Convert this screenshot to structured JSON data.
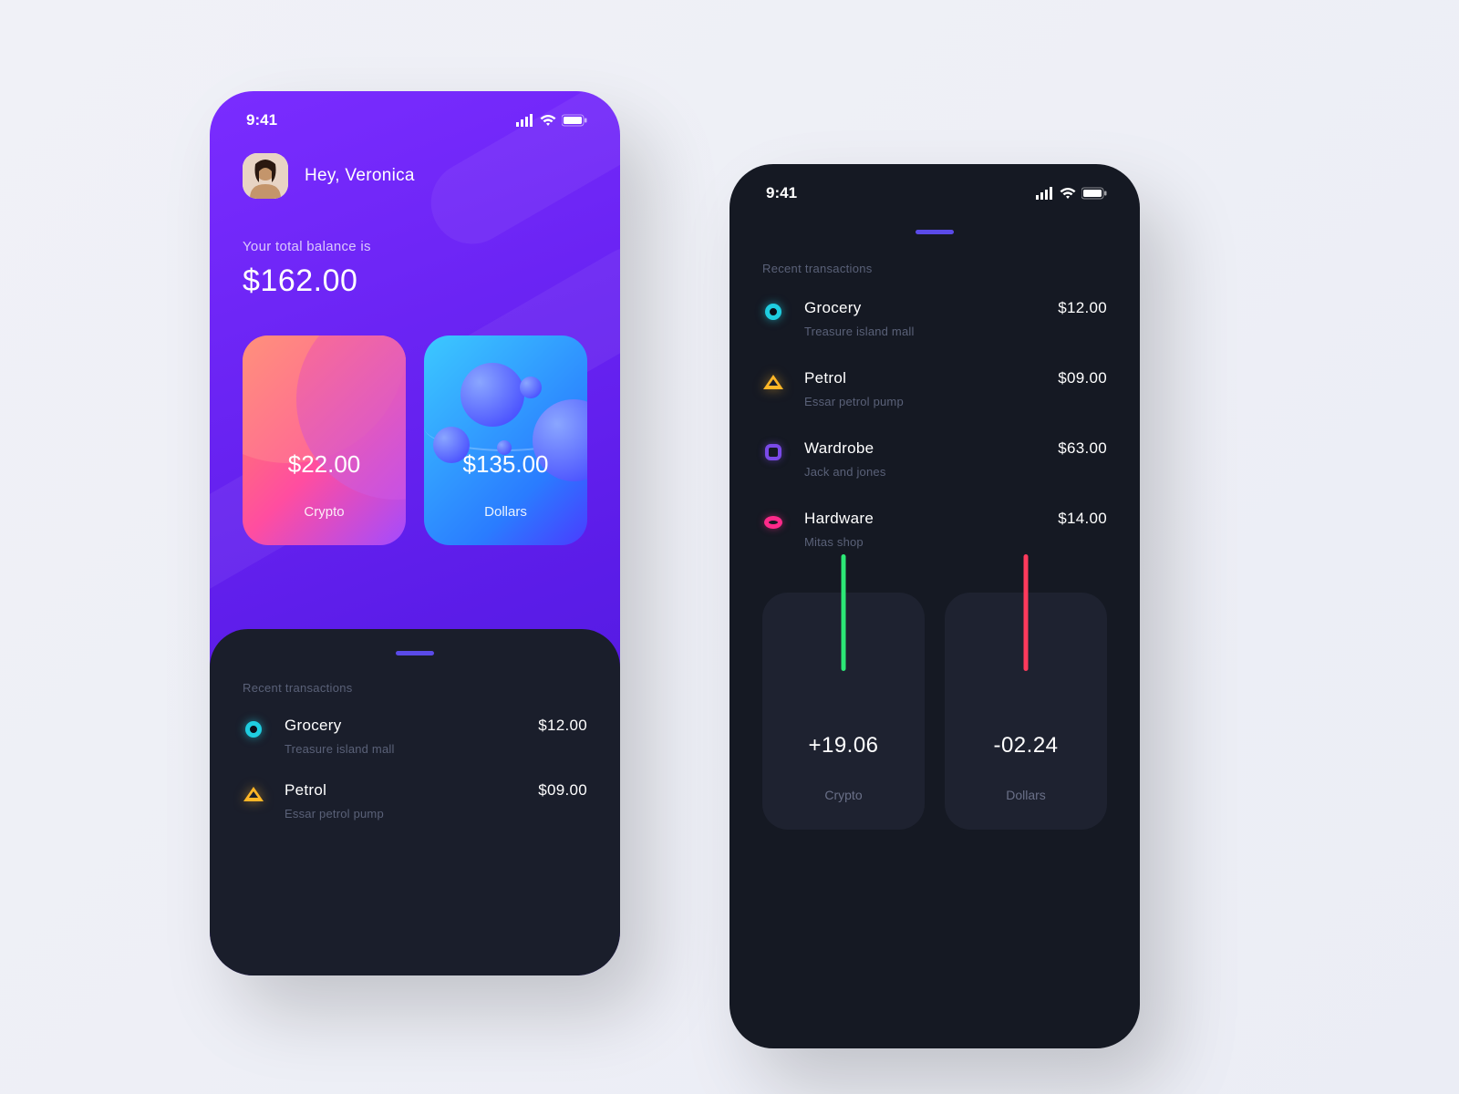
{
  "status_time": "9:41",
  "greeting": "Hey, Veronica",
  "balance_label": "Your total balance is",
  "balance_value": "$162.00",
  "cards": {
    "crypto": {
      "amount": "$22.00",
      "label": "Crypto"
    },
    "dollars": {
      "amount": "$135.00",
      "label": "Dollars"
    }
  },
  "recent_label": "Recent transactions",
  "transactions": [
    {
      "title": "Grocery",
      "sub": "Treasure island mall",
      "amount": "$12.00",
      "icon": "ring-cyan"
    },
    {
      "title": "Petrol",
      "sub": "Essar petrol pump",
      "amount": "$09.00",
      "icon": "triangle"
    },
    {
      "title": "Wardrobe",
      "sub": "Jack and jones",
      "amount": "$63.00",
      "icon": "square"
    },
    {
      "title": "Hardware",
      "sub": "Mitas shop",
      "amount": "$14.00",
      "icon": "ring-pink"
    }
  ],
  "stats": {
    "crypto": {
      "value": "+19.06",
      "label": "Crypto"
    },
    "dollars": {
      "value": "-02.24",
      "label": "Dollars"
    }
  }
}
